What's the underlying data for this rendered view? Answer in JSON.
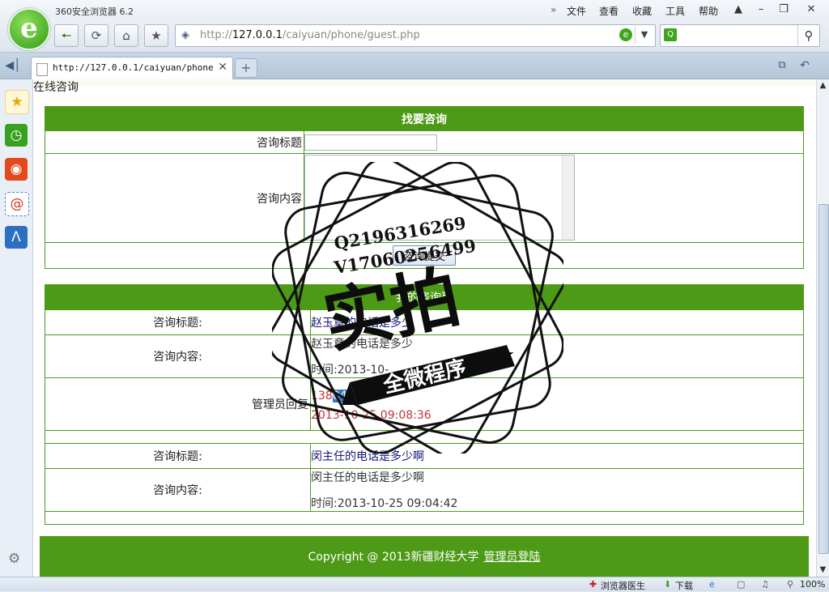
{
  "browser": {
    "title": "360安全浏览器 6.2",
    "menu": [
      "文件",
      "查看",
      "收藏",
      "工具",
      "帮助"
    ],
    "address": {
      "protocol": "http://",
      "host": "127.0.0.1",
      "path": "/caiyuan/phone/guest.php"
    },
    "tab": {
      "label": "http://127.0.0.1/caiyuan/phone/guest.php"
    }
  },
  "side_panel": {
    "icons": [
      "star-icon",
      "clock-icon",
      "weibo-icon",
      "mail-icon",
      "app-icon"
    ],
    "colors": [
      "#f3c21d",
      "#3aa020",
      "#e24a1c",
      "#e84d3a",
      "#2a6fc0"
    ]
  },
  "page": {
    "heading": "在线咨询",
    "form": {
      "header": "找要咨询",
      "title_label": "咨询标题",
      "content_label": "咨询内容",
      "submit_label": "咨询提交"
    },
    "list": {
      "header": "我的咨询列",
      "entries": [
        {
          "title_label": "咨询标题:",
          "title": "赵玉章的电话是多少",
          "content_label": "咨询内容:",
          "content": "赵玉章的电话是多少",
          "time": "时间:2013-10-",
          "reply_label": "管理员回复",
          "reply_text": "138",
          "reply_highlight": "04",
          "reply_time": "2013-10-25 09:08:36"
        },
        {
          "title_label": "咨询标题:",
          "title": "闵主任的电话是多少啊",
          "content_label": "咨询内容:",
          "content": "闵主任的电话是多少啊",
          "time": "时间:2013-10-25 09:04:42"
        }
      ]
    },
    "footer": {
      "copyright": "Copyright @ 2013新疆财经大学",
      "admin_link": "管理员登陆"
    }
  },
  "watermark": {
    "line1": "Q2196316269",
    "line2": "V17060256499",
    "big": "实拍",
    "banner": "全微程序"
  },
  "status": {
    "doctor": "浏览器医生",
    "download": "下载",
    "zoom": "100%"
  },
  "colors": {
    "green": "#4d9a16",
    "reply_red": "#c03434",
    "link_blue": "#11167a"
  }
}
